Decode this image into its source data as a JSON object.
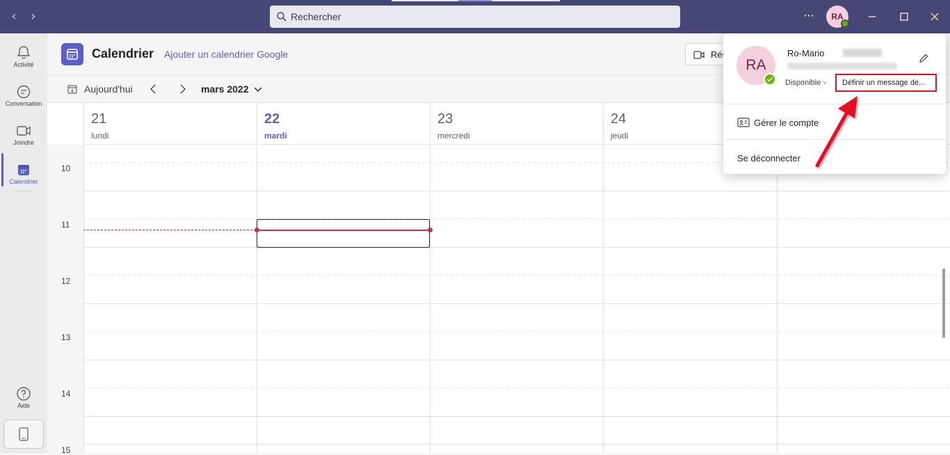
{
  "titlebar": {
    "search_placeholder": "Rechercher",
    "more_label": "···",
    "avatar_initials": "RA",
    "minimize": "—",
    "close": "✕",
    "back": "‹",
    "forward": "›"
  },
  "rail": {
    "items": [
      {
        "label": "Activité",
        "icon": "bell-icon"
      },
      {
        "label": "Conversation",
        "icon": "chat-icon"
      },
      {
        "label": "Joindre",
        "icon": "video-icon"
      },
      {
        "label": "Calendrier",
        "icon": "calendar-icon"
      },
      {
        "label": "Aide",
        "icon": "help-icon"
      }
    ]
  },
  "header": {
    "title": "Calendrier",
    "google_link": "Ajouter un calendrier Google",
    "meeting_button": "Réu"
  },
  "toolbar": {
    "today": "Aujourd'hui",
    "month": "mars 2022"
  },
  "days": [
    {
      "num": "21",
      "name": "lundi"
    },
    {
      "num": "22",
      "name": "mardi"
    },
    {
      "num": "23",
      "name": "mercredi"
    },
    {
      "num": "24",
      "name": "jeudi"
    }
  ],
  "hours": [
    "10",
    "11",
    "12",
    "13",
    "14",
    "15"
  ],
  "popup": {
    "initials": "RA",
    "name_first": "Ro-Mario",
    "status": "Disponible",
    "status_chevron": "˅",
    "set_message": "Définir un message de...",
    "manage_account": "Gérer le compte",
    "logout": "Se déconnecter"
  },
  "colors": {
    "titlebar": "#464775",
    "accent": "#5b5fc7",
    "now_line": "#c4314b",
    "available": "#6bb700",
    "highlight_box": "#e81123"
  }
}
